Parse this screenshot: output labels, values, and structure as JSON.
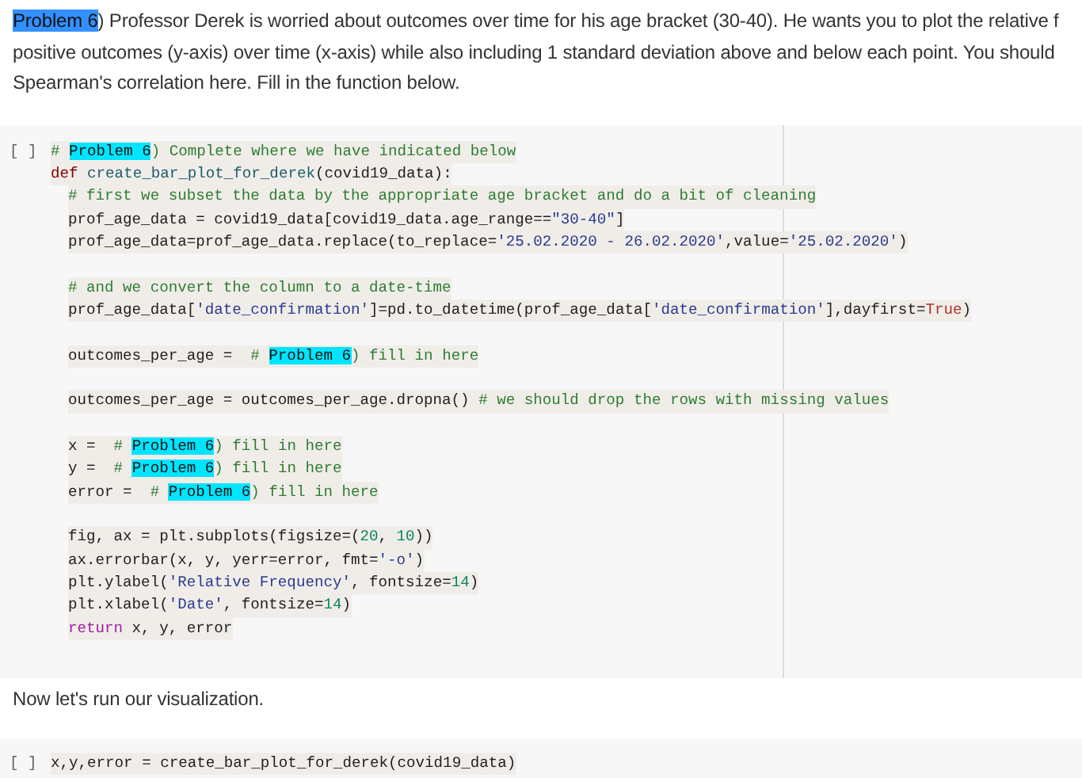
{
  "text_cell": {
    "lines": [
      [
        {
          "kind": "selected",
          "text": "Problem 6"
        },
        {
          "kind": "plain",
          "text": ") Professor Derek is worried about outcomes over time for his age bracket (30-40). He wants you to plot the relative f"
        }
      ],
      [
        {
          "kind": "plain",
          "text": "positive outcomes (y-axis) over time (x-axis) while also including 1 standard deviation above and below each point. You should"
        }
      ],
      [
        {
          "kind": "plain",
          "text": "Spearman's correlation here. Fill in the function below."
        }
      ]
    ]
  },
  "code_cell": {
    "run_label": "[ ]",
    "lines": [
      {
        "kind": "code",
        "tokens": [
          {
            "kind": "comment",
            "text": "# "
          },
          {
            "kind": "match",
            "text": "Problem 6"
          },
          {
            "kind": "comment",
            "text": ") Complete where we have indicated below"
          }
        ]
      },
      {
        "kind": "code",
        "tokens": [
          {
            "kind": "keyword",
            "text": "def"
          },
          {
            "kind": "func",
            "text": " create_bar_plot_for_derek"
          },
          {
            "kind": "plain",
            "text": "(covid19_data):"
          }
        ],
        "children": [
          {
            "kind": "code",
            "tokens": [
              {
                "kind": "comment",
                "text": "# first we subset the data by the appropriate age bracket and do a bit of cleaning"
              }
            ]
          },
          {
            "kind": "code",
            "tokens": [
              {
                "kind": "plain",
                "text": "prof_age_data = covid19_data[covid19_data.age_range=="
              },
              {
                "kind": "string",
                "text": "\"30-40\""
              },
              {
                "kind": "plain",
                "text": "]"
              }
            ]
          },
          {
            "kind": "code",
            "tokens": [
              {
                "kind": "plain",
                "text": "prof_age_data=prof_age_data.replace(to_replace="
              },
              {
                "kind": "string",
                "text": "'25.02.2020 - 26.02.2020'"
              },
              {
                "kind": "plain",
                "text": ",value="
              },
              {
                "kind": "string",
                "text": "'25.02.2020'"
              },
              {
                "kind": "plain",
                "text": ")"
              }
            ]
          },
          {
            "kind": "blank"
          },
          {
            "kind": "code",
            "tokens": [
              {
                "kind": "comment",
                "text": "# and we convert the column to a date-time"
              }
            ]
          },
          {
            "kind": "code",
            "tokens": [
              {
                "kind": "plain",
                "text": "prof_age_data["
              },
              {
                "kind": "string",
                "text": "'date_confirmation'"
              },
              {
                "kind": "plain",
                "text": "]=pd.to_datetime(prof_age_data["
              },
              {
                "kind": "string",
                "text": "'date_confirmation'"
              },
              {
                "kind": "plain",
                "text": "],dayfirst="
              },
              {
                "kind": "constant",
                "text": "True"
              },
              {
                "kind": "plain",
                "text": ")"
              }
            ]
          },
          {
            "kind": "blank"
          },
          {
            "kind": "code",
            "tokens": [
              {
                "kind": "plain",
                "text": "outcomes_per_age =  "
              },
              {
                "kind": "comment",
                "text": "# "
              },
              {
                "kind": "match",
                "text": "Problem 6"
              },
              {
                "kind": "comment",
                "text": ") fill in here"
              }
            ]
          },
          {
            "kind": "blank"
          },
          {
            "kind": "code",
            "tokens": [
              {
                "kind": "plain",
                "text": "outcomes_per_age = outcomes_per_age.dropna() "
              },
              {
                "kind": "comment",
                "text": "# we should drop the rows with missing values"
              }
            ]
          },
          {
            "kind": "blank"
          },
          {
            "kind": "code",
            "tokens": [
              {
                "kind": "plain",
                "text": "x =  "
              },
              {
                "kind": "comment",
                "text": "# "
              },
              {
                "kind": "match",
                "text": "Problem 6"
              },
              {
                "kind": "comment",
                "text": ") fill in here"
              }
            ]
          },
          {
            "kind": "code",
            "tokens": [
              {
                "kind": "plain",
                "text": "y =  "
              },
              {
                "kind": "comment",
                "text": "# "
              },
              {
                "kind": "match",
                "text": "Problem 6"
              },
              {
                "kind": "comment",
                "text": ") fill in here"
              }
            ]
          },
          {
            "kind": "code",
            "tokens": [
              {
                "kind": "plain",
                "text": "error =  "
              },
              {
                "kind": "comment",
                "text": "# "
              },
              {
                "kind": "match",
                "text": "Problem 6"
              },
              {
                "kind": "comment",
                "text": ") fill in here"
              }
            ]
          },
          {
            "kind": "blank"
          },
          {
            "kind": "code",
            "tokens": [
              {
                "kind": "plain",
                "text": "fig, ax = plt.subplots(figsize=("
              },
              {
                "kind": "number",
                "text": "20"
              },
              {
                "kind": "plain",
                "text": ", "
              },
              {
                "kind": "number",
                "text": "10"
              },
              {
                "kind": "plain",
                "text": "))"
              }
            ]
          },
          {
            "kind": "code",
            "tokens": [
              {
                "kind": "plain",
                "text": "ax.errorbar(x, y, yerr=error, fmt="
              },
              {
                "kind": "string",
                "text": "'-o'"
              },
              {
                "kind": "plain",
                "text": ")"
              }
            ]
          },
          {
            "kind": "code",
            "tokens": [
              {
                "kind": "plain",
                "text": "plt.ylabel("
              },
              {
                "kind": "string",
                "text": "'Relative Frequency'"
              },
              {
                "kind": "plain",
                "text": ", fontsize="
              },
              {
                "kind": "number",
                "text": "14"
              },
              {
                "kind": "plain",
                "text": ")"
              }
            ]
          },
          {
            "kind": "code",
            "tokens": [
              {
                "kind": "plain",
                "text": "plt.xlabel("
              },
              {
                "kind": "string",
                "text": "'Date'"
              },
              {
                "kind": "plain",
                "text": ", fontsize="
              },
              {
                "kind": "number",
                "text": "14"
              },
              {
                "kind": "plain",
                "text": ")"
              }
            ]
          },
          {
            "kind": "code",
            "tokens": [
              {
                "kind": "control",
                "text": "return"
              },
              {
                "kind": "plain",
                "text": " x, y, error"
              }
            ]
          }
        ]
      }
    ]
  },
  "text_cell_2": {
    "lines": [
      [
        {
          "kind": "plain",
          "text": "Now let's run our visualization."
        }
      ]
    ]
  },
  "code_cell_2": {
    "run_label": "[ ]",
    "lines": [
      {
        "kind": "code",
        "tokens": [
          {
            "kind": "plain",
            "text": "x,y,error = create_bar_plot_for_derek(covid19_data)"
          }
        ]
      }
    ]
  }
}
